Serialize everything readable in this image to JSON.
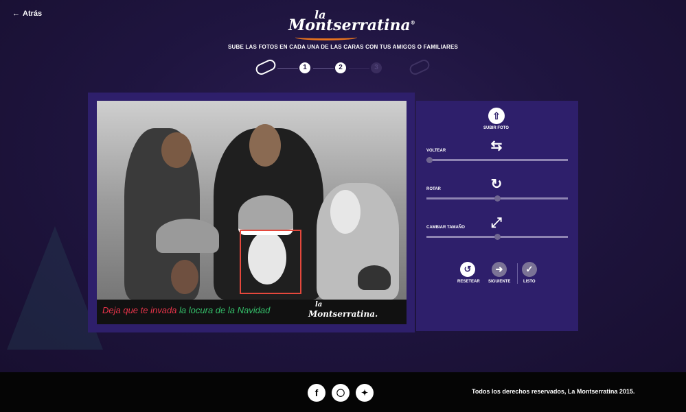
{
  "nav": {
    "back_label": "Atrás",
    "back_icon": "arrow-left-icon"
  },
  "logo": {
    "la": "la",
    "name": "Montserratina",
    "registered": "®"
  },
  "header": {
    "subtitle": "SUBE LAS FOTOS EN CADA UNA DE LAS CARAS CON TUS AMIGOS O FAMILIARES"
  },
  "steps": [
    "1",
    "2",
    "3"
  ],
  "canvas": {
    "banner_part1": "Deja que te invada",
    "banner_part2": "la locura de la Navidad",
    "banner_logo_la": "la",
    "banner_logo_name": "Montserratina."
  },
  "panel": {
    "upload_label": "SUBIR FOTO",
    "flip_label": "VOLTEAR",
    "rotate_label": "ROTAR",
    "resize_label": "CAMBIAR TAMAÑO",
    "reset_label": "RESETEAR",
    "next_label": "SIGUIENTE",
    "done_label": "LISTO",
    "flip_value": 0,
    "rotate_value": 0.5,
    "resize_value": 0.5
  },
  "footer": {
    "copyright": "Todos los derechos reservados, La Montserratina 2015.",
    "social": [
      "facebook-icon",
      "instagram-icon",
      "twitter-icon"
    ]
  },
  "colors": {
    "accent": "#e8731e",
    "panel": "#2e1f6b",
    "selection": "#e5483c",
    "banner_red": "#e8344a",
    "banner_green": "#34c06a"
  }
}
